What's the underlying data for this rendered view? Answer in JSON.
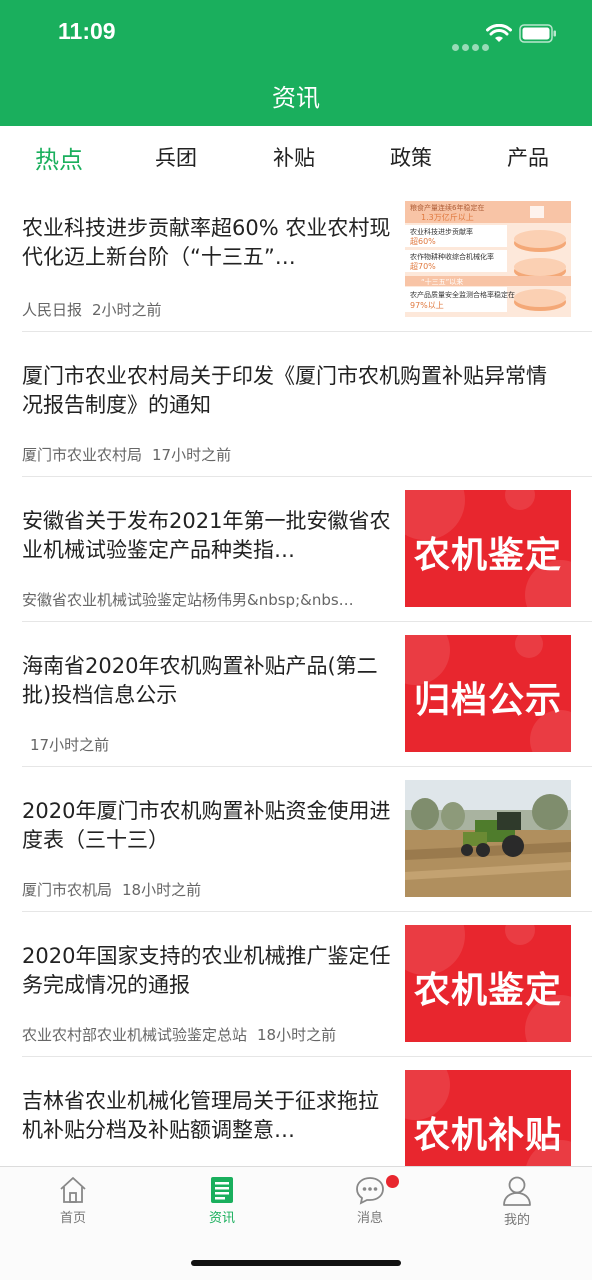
{
  "status": {
    "time": "11:09"
  },
  "header": {
    "title": "资讯"
  },
  "tabs": [
    {
      "label": "热点",
      "active": true
    },
    {
      "label": "兵团",
      "active": false
    },
    {
      "label": "补贴",
      "active": false
    },
    {
      "label": "政策",
      "active": false
    },
    {
      "label": "产品",
      "active": false
    }
  ],
  "articles": [
    {
      "title": "农业科技进步贡献率超60% 农业农村现代化迈上新台阶（“十三五”…",
      "source": "人民日报",
      "time": "2小时之前",
      "thumb": {
        "kind": "infographic",
        "lines": [
          "粮食产量连续6年稳定在",
          "1.3万亿斤以上",
          "农业科技进步贡献率",
          "超60%",
          "农作物耕种收综合机械化率",
          "超70%",
          "“十三五”以来",
          "农产品质量安全监测合格率稳定在",
          "97%以上"
        ]
      }
    },
    {
      "title": "厦门市农业农村局关于印发《厦门市农机购置补贴异常情况报告制度》的通知",
      "source": "厦门市农业农村局",
      "time": "17小时之前",
      "thumb": null
    },
    {
      "title": "安徽省关于发布2021年第一批安徽省农业机械试验鉴定产品种类指…",
      "source": "安徽省农业机械试验鉴定站杨伟男&nbsp;&nbs…",
      "time": "",
      "thumb": {
        "kind": "red-label",
        "label": "农机鉴定"
      }
    },
    {
      "title": "海南省2020年农机购置补贴产品(第二批)投档信息公示",
      "source": "",
      "time": "17小时之前",
      "thumb": {
        "kind": "red-label",
        "label": "归档公示"
      }
    },
    {
      "title": "2020年厦门市农机购置补贴资金使用进度表（三十三）",
      "source": "厦门市农机局",
      "time": "18小时之前",
      "thumb": {
        "kind": "photo",
        "subject": "tractor-in-field"
      }
    },
    {
      "title": "2020年国家支持的农业机械推广鉴定任务完成情况的通报",
      "source": "农业农村部农业机械试验鉴定总站",
      "time": "18小时之前",
      "thumb": {
        "kind": "red-label",
        "label": "农机鉴定"
      }
    },
    {
      "title": "吉林省农业机械化管理局关于征求拖拉机补贴分档及补贴额调整意…",
      "source": "",
      "time": "",
      "thumb": {
        "kind": "red-label",
        "label": "农机补贴"
      }
    }
  ],
  "tabbar": [
    {
      "label": "首页",
      "icon": "home-icon",
      "active": false
    },
    {
      "label": "资讯",
      "icon": "news-icon",
      "active": true
    },
    {
      "label": "消息",
      "icon": "message-icon",
      "active": false,
      "badge": true
    },
    {
      "label": "我的",
      "icon": "profile-icon",
      "active": false
    }
  ],
  "colors": {
    "brand": "#1aaf5d",
    "thumb_red": "#e8262e",
    "badge": "#e8262e"
  }
}
